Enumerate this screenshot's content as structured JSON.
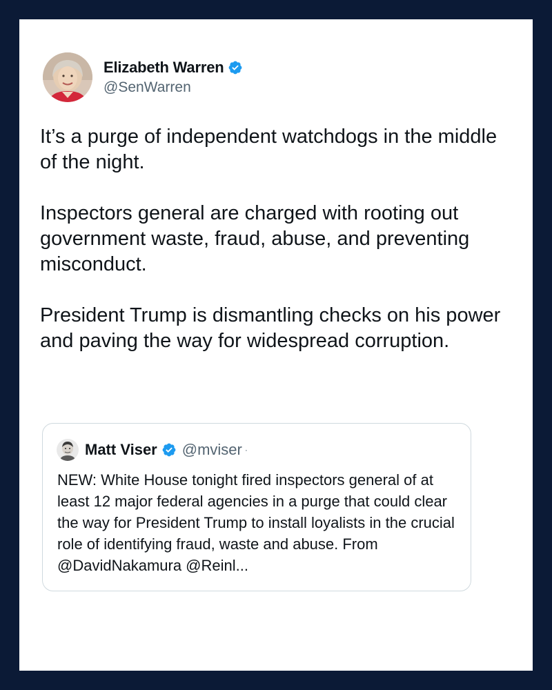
{
  "author": {
    "display_name": "Elizabeth Warren",
    "handle": "@SenWarren",
    "verified": true,
    "verified_icon": "verified-badge-icon"
  },
  "tweet": {
    "paragraphs": [
      "It’s a purge of independent watchdogs in the middle of the night.",
      "Inspectors general are charged with rooting out government waste, fraud, abuse, and preventing misconduct.",
      "President Trump is dismantling checks on his power and paving the way for widespread corruption."
    ]
  },
  "quoted_tweet": {
    "display_name": "Matt Viser",
    "handle": "@mviser",
    "separator": "·",
    "verified": true,
    "text": "NEW: White House tonight fired inspectors general of at least 12 major federal agencies in a purge that could clear the way for President Trump to install loyalists in the crucial role of identifying fraud, waste and abuse. From @DavidNakamura @Reinl..."
  },
  "colors": {
    "frame": "#0b1a36",
    "card": "#ffffff",
    "text": "#0f1419",
    "secondary_text": "#536471",
    "verified_blue": "#1d9bf0",
    "quote_border": "#cfd9de"
  }
}
